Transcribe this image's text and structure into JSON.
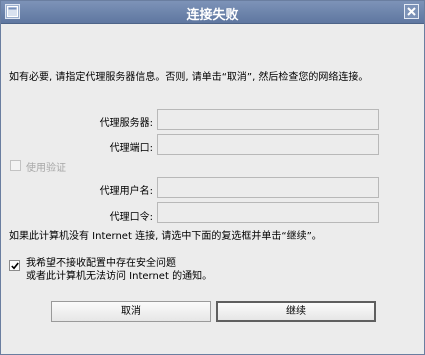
{
  "window": {
    "title": "连接失败"
  },
  "intro_text": "如有必要, 请指定代理服务器信息。否则, 请单击“取消”, 然后检查您的网络连接。",
  "fields": {
    "proxy_server_label": "代理服务器:",
    "proxy_server_value": "",
    "proxy_port_label": "代理端口:",
    "proxy_port_value": "",
    "proxy_user_label": "代理用户名:",
    "proxy_user_value": "",
    "proxy_password_label": "代理口令:",
    "proxy_password_value": ""
  },
  "use_auth": {
    "label": "使用验证",
    "checked": false,
    "enabled": false
  },
  "bypass_text": "如果此计算机没有 Internet 连接, 请选中下面的复选框并单击“继续”。",
  "warning_check": {
    "line1": "我希望不接收配置中存在安全问题",
    "line2": "或者此计算机无法访问 Internet 的通知。",
    "checked": true
  },
  "buttons": {
    "cancel": "取消",
    "continue": "继续"
  },
  "colors": {
    "titlebar": "#6b82a9",
    "window_bg": "#ececec"
  }
}
